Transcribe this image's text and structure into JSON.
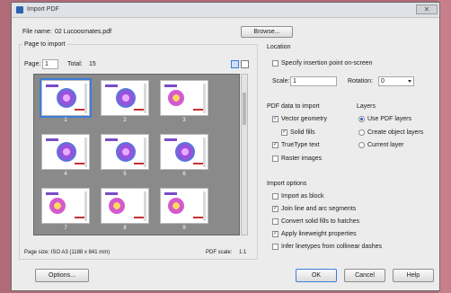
{
  "window": {
    "title": "Import PDF",
    "close_glyph": "✕"
  },
  "file": {
    "label": "File name:",
    "value": "02 Lucoosmates.pdf",
    "browse_label": "Browse..."
  },
  "page_to_import": {
    "section_label": "Page to import",
    "page_label": "Page:",
    "page_value": "1",
    "total_label": "Total:",
    "total_value": "15",
    "thumbnails": [
      {
        "caption": "1",
        "selected": true
      },
      {
        "caption": "2",
        "selected": false
      },
      {
        "caption": "3",
        "selected": false
      },
      {
        "caption": "4",
        "selected": false
      },
      {
        "caption": "5",
        "selected": false
      },
      {
        "caption": "6",
        "selected": false
      },
      {
        "caption": "7",
        "selected": false
      },
      {
        "caption": "8",
        "selected": false
      },
      {
        "caption": "9",
        "selected": false
      }
    ],
    "page_size_text": "Page size: ISO A3 (1188 x 841 mm)",
    "pdf_scale_label": "PDF scale:",
    "pdf_scale_value": "1:1"
  },
  "location": {
    "section_label": "Location",
    "specify_label": "Specify insertion point on-screen",
    "scale_label": "Scale:",
    "scale_value": "1",
    "rotation_label": "Rotation:",
    "rotation_value": "0"
  },
  "pdf_data": {
    "section_label": "PDF data to import",
    "vector_label": "Vector geometry",
    "solid_fills_label": "Solid fills",
    "truetype_label": "TrueType text",
    "raster_label": "Raster images"
  },
  "layers": {
    "section_label": "Layers",
    "use_pdf_label": "Use PDF layers",
    "create_label": "Create object layers",
    "current_label": "Current layer"
  },
  "import_options": {
    "section_label": "Import options",
    "block_label": "Import as block",
    "join_label": "Join line and arc segments",
    "convert_label": "Convert solid fills to hatches",
    "apply_label": "Apply lineweight properties",
    "infer_label": "Infer linetypes from collinear dashes"
  },
  "buttons": {
    "options": "Options...",
    "ok": "OK",
    "cancel": "Cancel",
    "help": "Help"
  },
  "colors": {
    "accent": "#3b7dd8",
    "preview_bg": "#8a8a8a"
  }
}
